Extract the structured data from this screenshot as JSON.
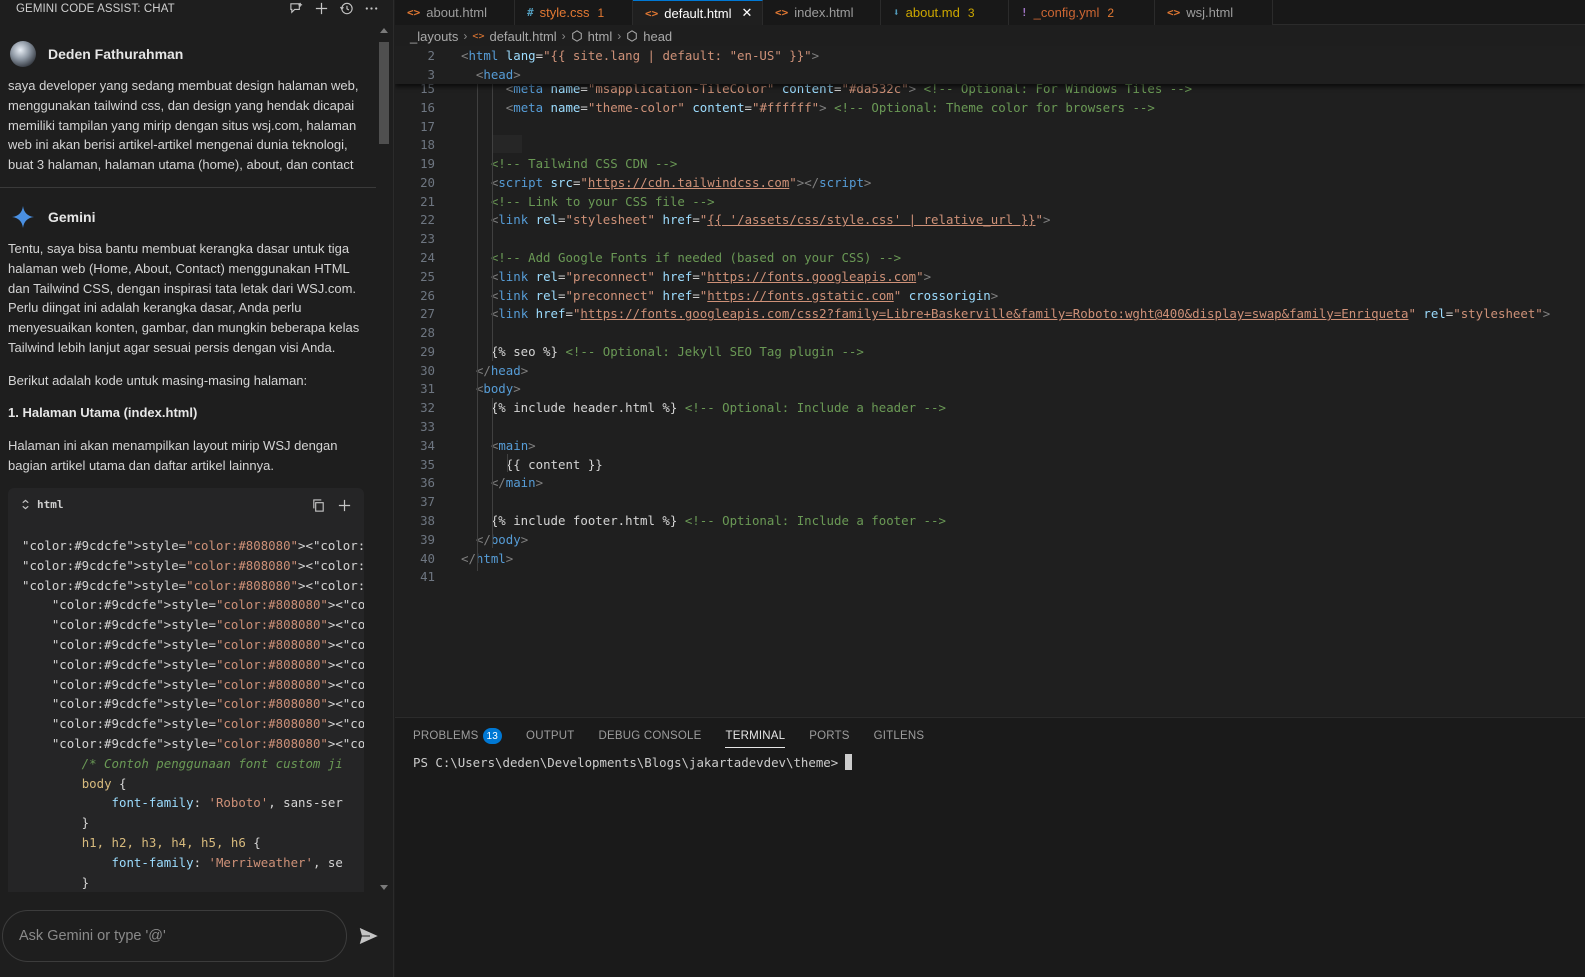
{
  "chat": {
    "header_title": "GEMINI CODE ASSIST: CHAT",
    "header_icons": [
      "new-chat-icon",
      "plus-icon",
      "history-icon",
      "more-icon"
    ],
    "user_name": "Deden Fathurahman",
    "user_message": "saya developer yang sedang membuat design halaman web, menggunakan tailwind css, dan design yang hendak dicapai memiliki tampilan yang mirip dengan situs wsj.com, halaman web ini akan berisi artikel-artikel mengenai dunia teknologi, buat 3 halaman, halaman utama (home), about, dan contact",
    "assistant_name": "Gemini",
    "assistant_p1": "Tentu, saya bisa bantu membuat kerangka dasar untuk tiga halaman web (Home, About, Contact) menggunakan HTML dan Tailwind CSS, dengan inspirasi tata letak dari WSJ.com. Perlu diingat ini adalah kerangka dasar, Anda perlu menyesuaikan konten, gambar, dan mungkin beberapa kelas Tailwind lebih lanjut agar sesuai persis dengan visi Anda.",
    "assistant_p2": "Berikut adalah kode untuk masing-masing halaman:",
    "assistant_heading": "1. Halaman Utama (index.html)",
    "assistant_p3": "Halaman ini akan menampilkan layout mirip WSJ dengan bagian artikel utama dan daftar artikel lainnya.",
    "code_lang": "html",
    "code_lines": [
      "<!DOCTYPE html>",
      "<html lang=\"id\">",
      "<head>",
      "    <meta charset=\"UTF-8\">",
      "    <meta name=\"viewport\" content=\"width=de",
      "    <title>Tech Insights - Beranda</title>",
      "    <script src=\"https://cdn.tailwindcss.co",
      "    <link rel=\"preconnect\" href=\"https://fo",
      "    <link rel=\"preconnect\" href=\"https://fo",
      "    <link href=\"https://fonts.googleapis.co",
      "    <style>",
      "        /* Contoh penggunaan font custom ji",
      "        body {",
      "            font-family: 'Roboto', sans-ser",
      "        }",
      "        h1, h2, h3, h4, h5, h6 {",
      "            font-family: 'Merriweather', se",
      "        }"
    ],
    "input_placeholder": "Ask Gemini or type '@'"
  },
  "tabs": [
    {
      "icon": "<>",
      "label": "about.html",
      "badge": "",
      "color": "#e37933",
      "active": false
    },
    {
      "icon": "#",
      "label": "style.css",
      "badge": "1",
      "color": "#519aba",
      "active": false
    },
    {
      "icon": "<>",
      "label": "default.html",
      "badge": "",
      "color": "#e37933",
      "active": true
    },
    {
      "icon": "<>",
      "label": "index.html",
      "badge": "",
      "color": "#e37933",
      "active": false
    },
    {
      "icon": "md",
      "label": "about.md",
      "badge": "3",
      "color": "#519aba",
      "active": false
    },
    {
      "icon": "!",
      "label": "_config.yml",
      "badge": "2",
      "color": "#a074c4",
      "active": false
    },
    {
      "icon": "<>",
      "label": "wsj.html",
      "badge": "",
      "color": "#e37933",
      "active": false
    }
  ],
  "breadcrumb": [
    "_layouts",
    "default.html",
    "html",
    "head"
  ],
  "editor": {
    "sticky_lines": [
      {
        "n": "2",
        "html": "<span class='t-punc'>&lt;</span><span class='t-tagname'>html</span> <span class='t-attr'>lang</span><span class='t-plain'>=</span><span class='t-str'>\"{{ site.lang | default: \"en-US\" }}\"</span><span class='t-punc'>&gt;</span>"
      },
      {
        "n": "3",
        "html": "  <span class='t-punc'>&lt;</span><span class='t-tagname'>head</span><span class='t-punc'>&gt;</span>"
      }
    ],
    "lines": [
      {
        "n": "15",
        "html": "      <span class='t-punc'>&lt;</span><span class='t-tagname'>meta</span> <span class='t-attr'>name</span>=<span class='t-str'>\"msapplication-TileColor\"</span> <span class='t-attr'>content</span>=<span class='t-str'>\"#da532c\"</span><span class='t-punc'>&gt;</span> <span class='t-com'>&lt;!-- Optional: For Windows Tiles --&gt;</span>"
      },
      {
        "n": "16",
        "html": "      <span class='t-punc'>&lt;</span><span class='t-tagname'>meta</span> <span class='t-attr'>name</span>=<span class='t-str'>\"theme-color\"</span> <span class='t-attr'>content</span>=<span class='t-str'>\"#ffffff\"</span><span class='t-punc'>&gt;</span> <span class='t-com'>&lt;!-- Optional: Theme color for browsers --&gt;</span>"
      },
      {
        "n": "17",
        "html": ""
      },
      {
        "n": "18",
        "html": ""
      },
      {
        "n": "19",
        "html": "    <span class='t-com'>&lt;!-- Tailwind CSS CDN --&gt;</span>"
      },
      {
        "n": "20",
        "html": "    <span class='t-punc'>&lt;</span><span class='t-tagname'>script</span> <span class='t-attr'>src</span>=<span class='t-str'>\"<span class='t-url'>https://cdn.tailwindcss.com</span>\"</span><span class='t-punc'>&gt;&lt;/</span><span class='t-tagname'>script</span><span class='t-punc'>&gt;</span>"
      },
      {
        "n": "21",
        "html": "    <span class='t-com'>&lt;!-- Link to your CSS file --&gt;</span>"
      },
      {
        "n": "22",
        "html": "    <span class='t-punc'>&lt;</span><span class='t-tagname'>link</span> <span class='t-attr'>rel</span>=<span class='t-str'>\"stylesheet\"</span> <span class='t-attr'>href</span>=<span class='t-str'>\"<span class='t-url'>{{ '/assets/css/style.css' | relative_url }}</span>\"</span><span class='t-punc'>&gt;</span>"
      },
      {
        "n": "23",
        "html": ""
      },
      {
        "n": "24",
        "html": "    <span class='t-com'>&lt;!-- Add Google Fonts if needed (based on your CSS) --&gt;</span>"
      },
      {
        "n": "25",
        "html": "    <span class='t-punc'>&lt;</span><span class='t-tagname'>link</span> <span class='t-attr'>rel</span>=<span class='t-str'>\"preconnect\"</span> <span class='t-attr'>href</span>=<span class='t-str'>\"<span class='t-url'>https://fonts.googleapis.com</span>\"</span><span class='t-punc'>&gt;</span>"
      },
      {
        "n": "26",
        "html": "    <span class='t-punc'>&lt;</span><span class='t-tagname'>link</span> <span class='t-attr'>rel</span>=<span class='t-str'>\"preconnect\"</span> <span class='t-attr'>href</span>=<span class='t-str'>\"<span class='t-url'>https://fonts.gstatic.com</span>\"</span> <span class='t-attr'>crossorigin</span><span class='t-punc'>&gt;</span>"
      },
      {
        "n": "27",
        "html": "    <span class='t-punc'>&lt;</span><span class='t-tagname'>link</span> <span class='t-attr'>href</span>=<span class='t-str'>\"<span class='t-url'>https://fonts.googleapis.com/css2?family=Libre+Baskerville&amp;family=Roboto:wght@400&amp;display=swap&amp;family=Enriqueta</span>\"</span> <span class='t-attr'>rel</span>=<span class='t-str'>\"stylesheet\"</span><span class='t-punc'>&gt;</span>"
      },
      {
        "n": "28",
        "html": ""
      },
      {
        "n": "29",
        "html": "    <span class='t-plain'>{% seo %}</span> <span class='t-com'>&lt;!-- Optional: Jekyll SEO Tag plugin --&gt;</span>"
      },
      {
        "n": "30",
        "html": "  <span class='t-punc'>&lt;/</span><span class='t-tagname'>head</span><span class='t-punc'>&gt;</span>"
      },
      {
        "n": "31",
        "html": "  <span class='t-punc'>&lt;</span><span class='t-tagname'>body</span><span class='t-punc'>&gt;</span>"
      },
      {
        "n": "32",
        "html": "    <span class='t-plain'>{% include header.html %}</span> <span class='t-com'>&lt;!-- Optional: Include a header --&gt;</span>"
      },
      {
        "n": "33",
        "html": ""
      },
      {
        "n": "34",
        "html": "    <span class='t-punc'>&lt;</span><span class='t-tagname'>main</span><span class='t-punc'>&gt;</span>"
      },
      {
        "n": "35",
        "html": "      <span class='t-plain'>{{ content }}</span>"
      },
      {
        "n": "36",
        "html": "    <span class='t-punc'>&lt;/</span><span class='t-tagname'>main</span><span class='t-punc'>&gt;</span>"
      },
      {
        "n": "37",
        "html": ""
      },
      {
        "n": "38",
        "html": "    <span class='t-plain'>{% include footer.html %}</span> <span class='t-com'>&lt;!-- Optional: Include a footer --&gt;</span>"
      },
      {
        "n": "39",
        "html": "  <span class='t-punc'>&lt;/</span><span class='t-tagname'>body</span><span class='t-punc'>&gt;</span>"
      },
      {
        "n": "40",
        "html": "<span class='t-punc'>&lt;/</span><span class='t-tagname'>html</span><span class='t-punc'>&gt;</span>"
      },
      {
        "n": "41",
        "html": ""
      }
    ]
  },
  "panel": {
    "tabs": [
      {
        "label": "PROBLEMS",
        "badge": "13",
        "active": false
      },
      {
        "label": "OUTPUT",
        "badge": "",
        "active": false
      },
      {
        "label": "DEBUG CONSOLE",
        "badge": "",
        "active": false
      },
      {
        "label": "TERMINAL",
        "badge": "",
        "active": true
      },
      {
        "label": "PORTS",
        "badge": "",
        "active": false
      },
      {
        "label": "GITLENS",
        "badge": "",
        "active": false
      }
    ],
    "terminal_prompt": "PS C:\\Users\\deden\\Developments\\Blogs\\jakartadevdev\\theme>"
  },
  "colors": {
    "accent": "#0078d4",
    "gemini_star": "#4a90e2"
  }
}
